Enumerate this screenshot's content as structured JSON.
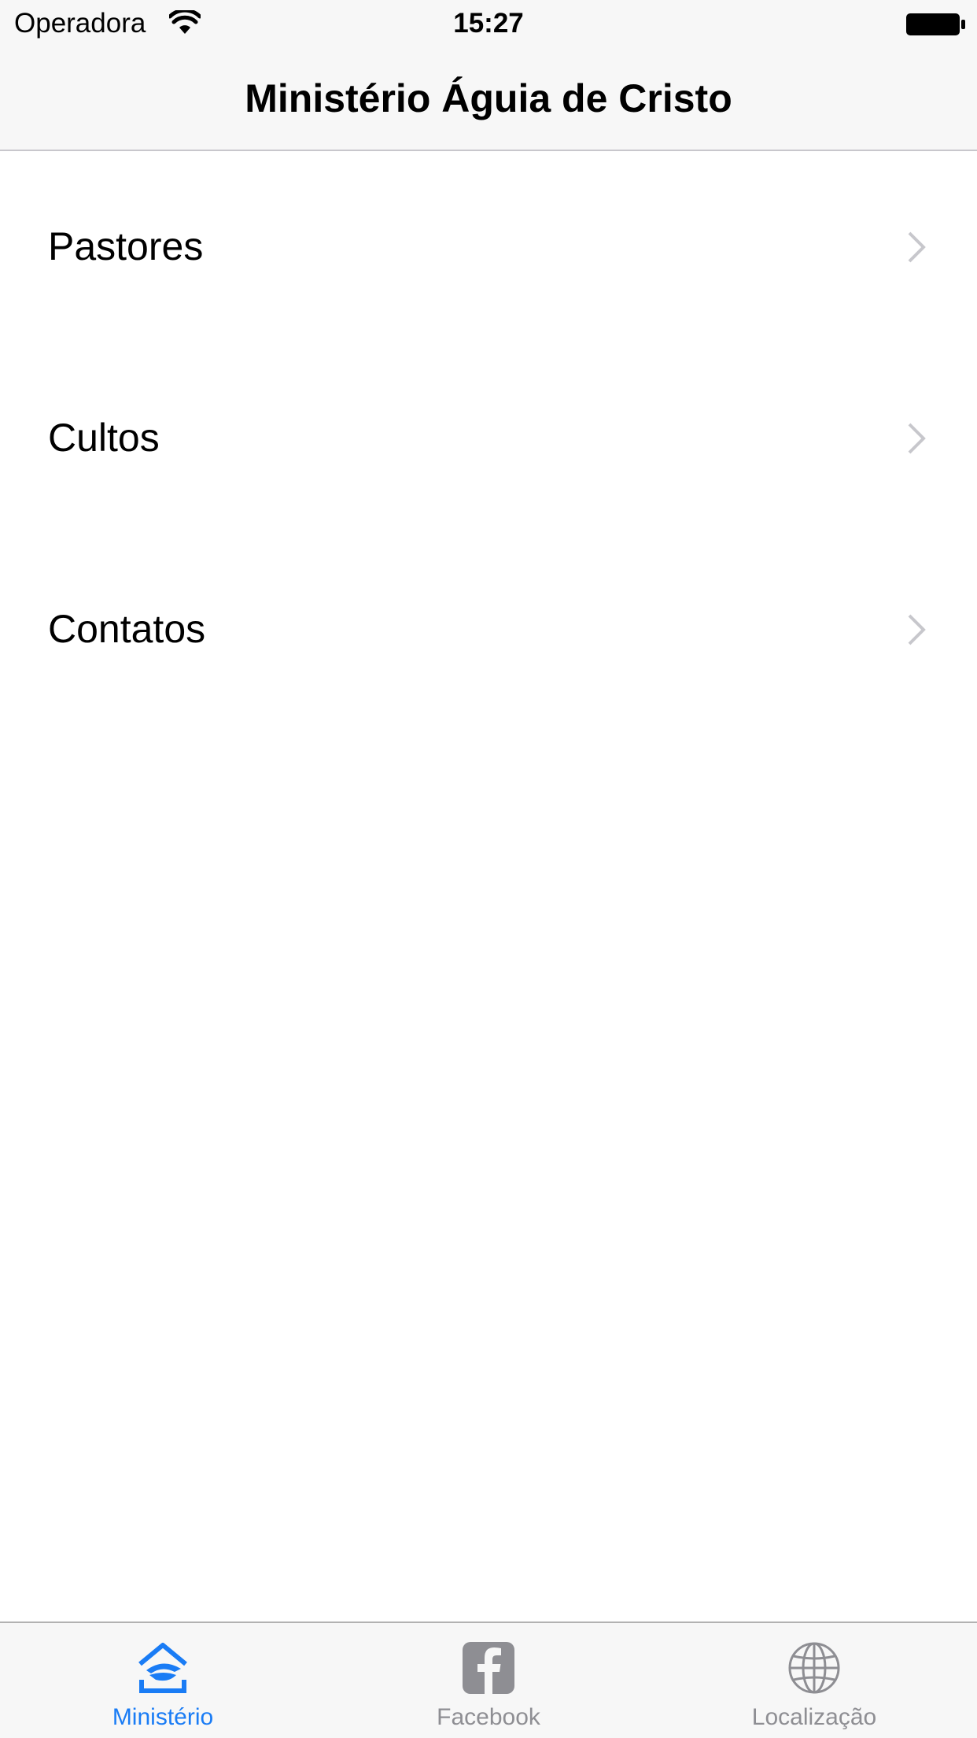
{
  "status_bar": {
    "carrier": "Operadora",
    "time": "15:27",
    "wifi_icon": "wifi-icon",
    "battery_icon": "battery-icon"
  },
  "nav": {
    "title": "Ministério Águia de Cristo"
  },
  "menu": {
    "items": [
      {
        "label": "Pastores",
        "icon": "chevron-right-icon"
      },
      {
        "label": "Cultos",
        "icon": "chevron-right-icon"
      },
      {
        "label": "Contatos",
        "icon": "chevron-right-icon"
      }
    ]
  },
  "tabs": {
    "items": [
      {
        "label": "Ministério",
        "icon": "eagle-home-icon",
        "active": true
      },
      {
        "label": "Facebook",
        "icon": "facebook-icon",
        "active": false
      },
      {
        "label": "Localização",
        "icon": "globe-icon",
        "active": false
      }
    ]
  },
  "colors": {
    "accent": "#1a7cf5",
    "inactive": "#8e8e93",
    "bar_background": "#f7f7f7",
    "chevron": "#c7c7cc"
  }
}
